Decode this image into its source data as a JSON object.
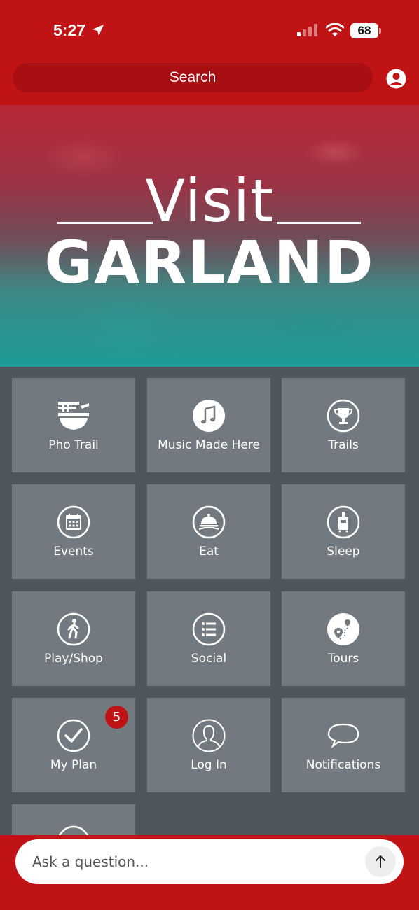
{
  "status_bar": {
    "time": "5:27",
    "battery": "68"
  },
  "header": {
    "search_label": "Search"
  },
  "hero": {
    "visit": "Visit",
    "city": "GARLAND"
  },
  "tiles": [
    {
      "label": "Pho Trail",
      "icon": "noodle-bowl-icon"
    },
    {
      "label": "Music Made Here",
      "icon": "music-note-icon"
    },
    {
      "label": "Trails",
      "icon": "trophy-icon"
    },
    {
      "label": "Events",
      "icon": "calendar-icon"
    },
    {
      "label": "Eat",
      "icon": "cloche-icon"
    },
    {
      "label": "Sleep",
      "icon": "luggage-icon"
    },
    {
      "label": "Play/Shop",
      "icon": "walking-person-icon"
    },
    {
      "label": "Social",
      "icon": "list-icon"
    },
    {
      "label": "Tours",
      "icon": "map-pins-icon"
    },
    {
      "label": "My Plan",
      "icon": "checkmark-icon",
      "badge": "5"
    },
    {
      "label": "Log In",
      "icon": "user-outline-icon"
    },
    {
      "label": "Notifications",
      "icon": "speech-bubble-icon"
    }
  ],
  "ask": {
    "placeholder": "Ask a question..."
  },
  "colors": {
    "brand_red": "#c01315",
    "tile_gray": "#737a7f",
    "background": "#4f565e"
  }
}
